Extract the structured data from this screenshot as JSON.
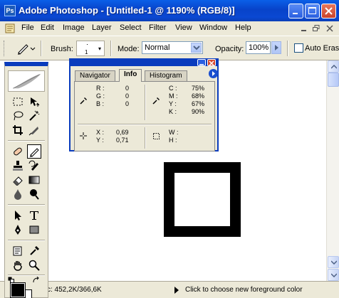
{
  "window": {
    "title": "Adobe Photoshop - [Untitled-1 @ 1190% (RGB/8)]",
    "app_icon_text": "Ps"
  },
  "menu": {
    "items": [
      "File",
      "Edit",
      "Image",
      "Layer",
      "Select",
      "Filter",
      "View",
      "Window",
      "Help"
    ]
  },
  "options": {
    "brush_label": "Brush:",
    "brush_size": "1",
    "mode_label": "Mode:",
    "mode_value": "Normal",
    "opacity_label": "Opacity:",
    "opacity_value": "100%",
    "auto_erase_label": "Auto Eras"
  },
  "info_palette": {
    "tabs": [
      "Navigator",
      "Info",
      "Histogram"
    ],
    "active_tab": "Info",
    "rgb": [
      {
        "label": "R :",
        "value": "0"
      },
      {
        "label": "G :",
        "value": "0"
      },
      {
        "label": "B :",
        "value": "0"
      }
    ],
    "cmyk": [
      {
        "label": "C :",
        "value": "75%"
      },
      {
        "label": "M :",
        "value": "68%"
      },
      {
        "label": "Y :",
        "value": "67%"
      },
      {
        "label": "K :",
        "value": "90%"
      }
    ],
    "xy": [
      {
        "label": "X :",
        "value": "0,69"
      },
      {
        "label": "Y :",
        "value": "0,71"
      }
    ],
    "wh": [
      {
        "label": "W :",
        "value": ""
      },
      {
        "label": "H :",
        "value": ""
      }
    ]
  },
  "status": {
    "doc_info": "c: 452,2K/366,6K",
    "message": "Click to choose new foreground color"
  },
  "colors": {
    "titlebar": "#0a48d2",
    "chrome": "#ece9d8",
    "foreground": "#000000",
    "background": "#ffffff"
  }
}
